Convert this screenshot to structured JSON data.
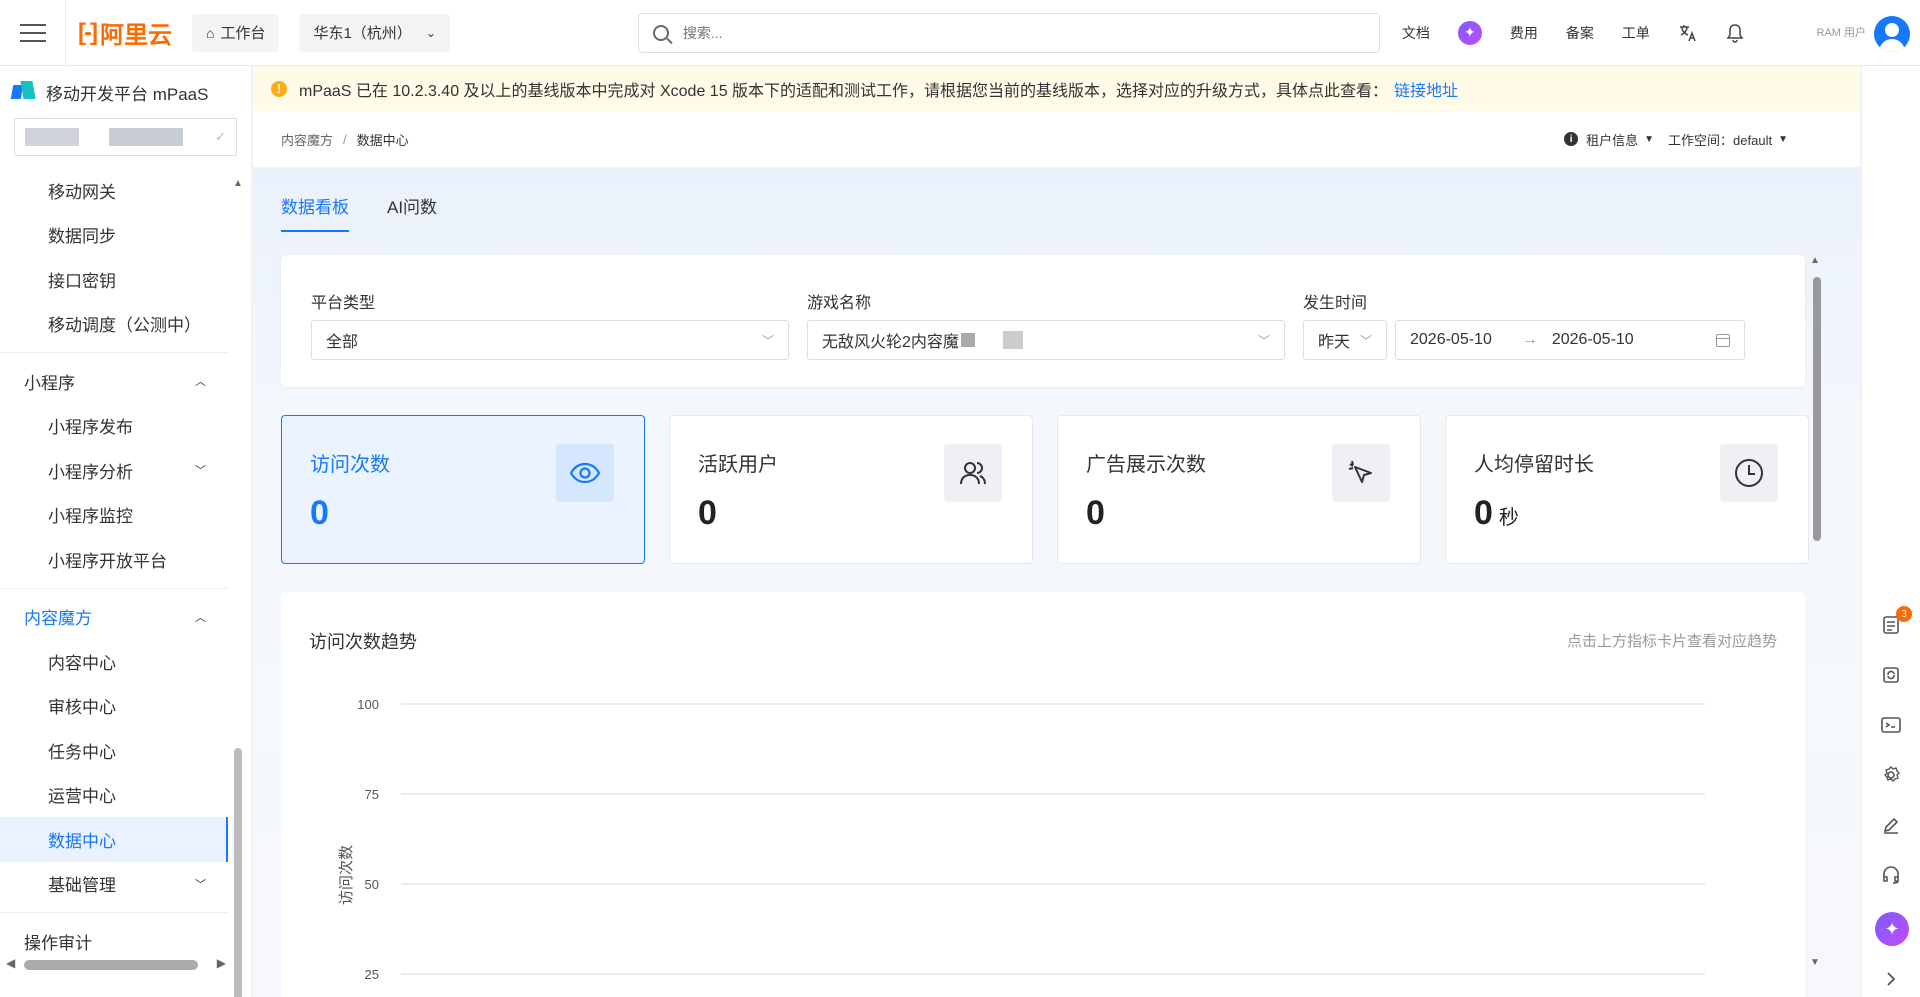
{
  "header": {
    "logo_text": "阿里云",
    "workbench": "工作台",
    "region": "华东1（杭州）",
    "search_placeholder": "搜索...",
    "links": [
      "文档",
      "费用",
      "备案",
      "工单"
    ],
    "user_label": "RAM 用户"
  },
  "sidebar": {
    "product_title": "移动开发平台 mPaaS",
    "items": [
      {
        "label": "移动网关",
        "type": "item"
      },
      {
        "label": "数据同步",
        "type": "item"
      },
      {
        "label": "接口密钥",
        "type": "item"
      },
      {
        "label": "移动调度（公测中）",
        "type": "item"
      },
      {
        "label": "小程序",
        "type": "group",
        "arrow": "up"
      },
      {
        "label": "小程序发布",
        "type": "item"
      },
      {
        "label": "小程序分析",
        "type": "item",
        "arrow": "down"
      },
      {
        "label": "小程序监控",
        "type": "item"
      },
      {
        "label": "小程序开放平台",
        "type": "item"
      },
      {
        "label": "内容魔方",
        "type": "group",
        "arrow": "up",
        "highlight": true
      },
      {
        "label": "内容中心",
        "type": "item"
      },
      {
        "label": "审核中心",
        "type": "item"
      },
      {
        "label": "任务中心",
        "type": "item"
      },
      {
        "label": "运营中心",
        "type": "item"
      },
      {
        "label": "数据中心",
        "type": "item",
        "active": true
      },
      {
        "label": "基础管理",
        "type": "item",
        "arrow": "down"
      },
      {
        "label": "操作审计",
        "type": "group"
      }
    ]
  },
  "notice": {
    "text": "mPaaS 已在 10.2.3.40 及以上的基线版本中完成对 Xcode 15 版本下的适配和测试工作，请根据您当前的基线版本，选择对应的升级方式，具体点此查看：",
    "link": "链接地址"
  },
  "breadcrumb": {
    "parent": "内容魔方",
    "separator": "/",
    "current": "数据中心",
    "tenant": "租户信息",
    "workspace": "工作空间：default"
  },
  "tabs": [
    {
      "label": "数据看板",
      "active": true
    },
    {
      "label": "AI问数",
      "active": false
    }
  ],
  "filters": {
    "platform_label": "平台类型",
    "platform_value": "全部",
    "game_label": "游戏名称",
    "game_value": "无敌风火轮2内容魔",
    "time_label": "发生时间",
    "time_preset": "昨天",
    "start_date": "2026-05-10",
    "end_date": "2026-05-10"
  },
  "cards": [
    {
      "title": "访问次数",
      "value": "0",
      "unit": "",
      "icon": "eye-icon",
      "active": true
    },
    {
      "title": "活跃用户",
      "value": "0",
      "unit": "",
      "icon": "users-icon",
      "active": false
    },
    {
      "title": "广告展示次数",
      "value": "0",
      "unit": "",
      "icon": "cursor-click-icon",
      "active": false
    },
    {
      "title": "人均停留时长",
      "value": "0",
      "unit": "秒",
      "icon": "clock-icon",
      "active": false
    }
  ],
  "chart": {
    "title": "访问次数趋势",
    "hint": "点击上方指标卡片查看对应趋势"
  },
  "chart_data": {
    "type": "line",
    "title": "访问次数趋势",
    "ylabel": "访问次数",
    "xlabel": "",
    "y_ticks": [
      100,
      75,
      50,
      25
    ],
    "ylim": [
      0,
      100
    ],
    "series": [],
    "grid": true
  },
  "right_tools": {
    "badge_count": "3"
  },
  "colors": {
    "brand": "#ff6a00",
    "accent": "#1677ff",
    "notice_bg": "#fffbe8"
  }
}
